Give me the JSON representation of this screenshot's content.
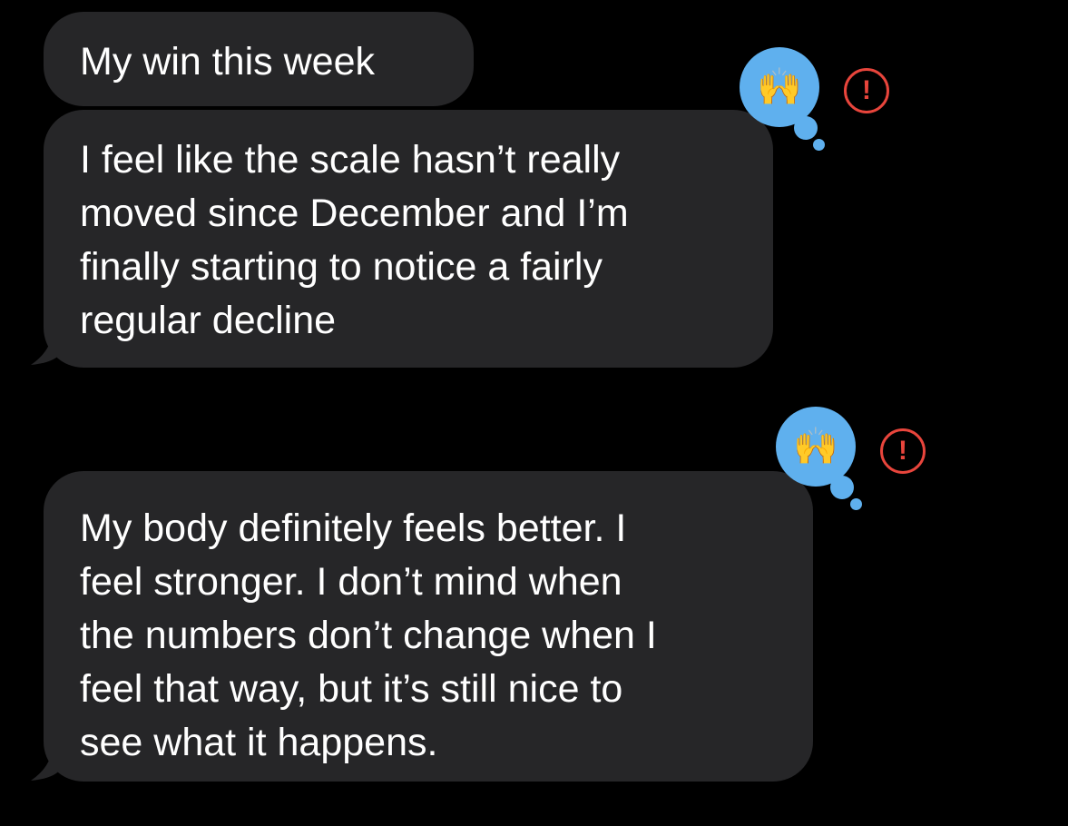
{
  "messages": [
    {
      "text": "My win this week"
    },
    {
      "text": "I feel like the scale hasn’t really\nmoved since December and I’m\nfinally starting to notice a fairly\nregular decline"
    },
    {
      "text": "My body definitely feels better. I\nfeel stronger. I don’t mind when\nthe numbers don’t change when I\nfeel that way, but it’s still nice to\nsee what it happens."
    }
  ],
  "reactions": [
    {
      "emoji": "🙌",
      "icon": "raising-hands-icon",
      "status_icon": "error-icon",
      "status_glyph": "!"
    },
    {
      "emoji": "🙌",
      "icon": "raising-hands-icon",
      "status_icon": "error-icon",
      "status_glyph": "!"
    }
  ],
  "colors": {
    "background": "#000000",
    "bubble": "#262628",
    "text": "#ffffff",
    "reaction": "#5fb0ee",
    "error": "#e8453c"
  }
}
